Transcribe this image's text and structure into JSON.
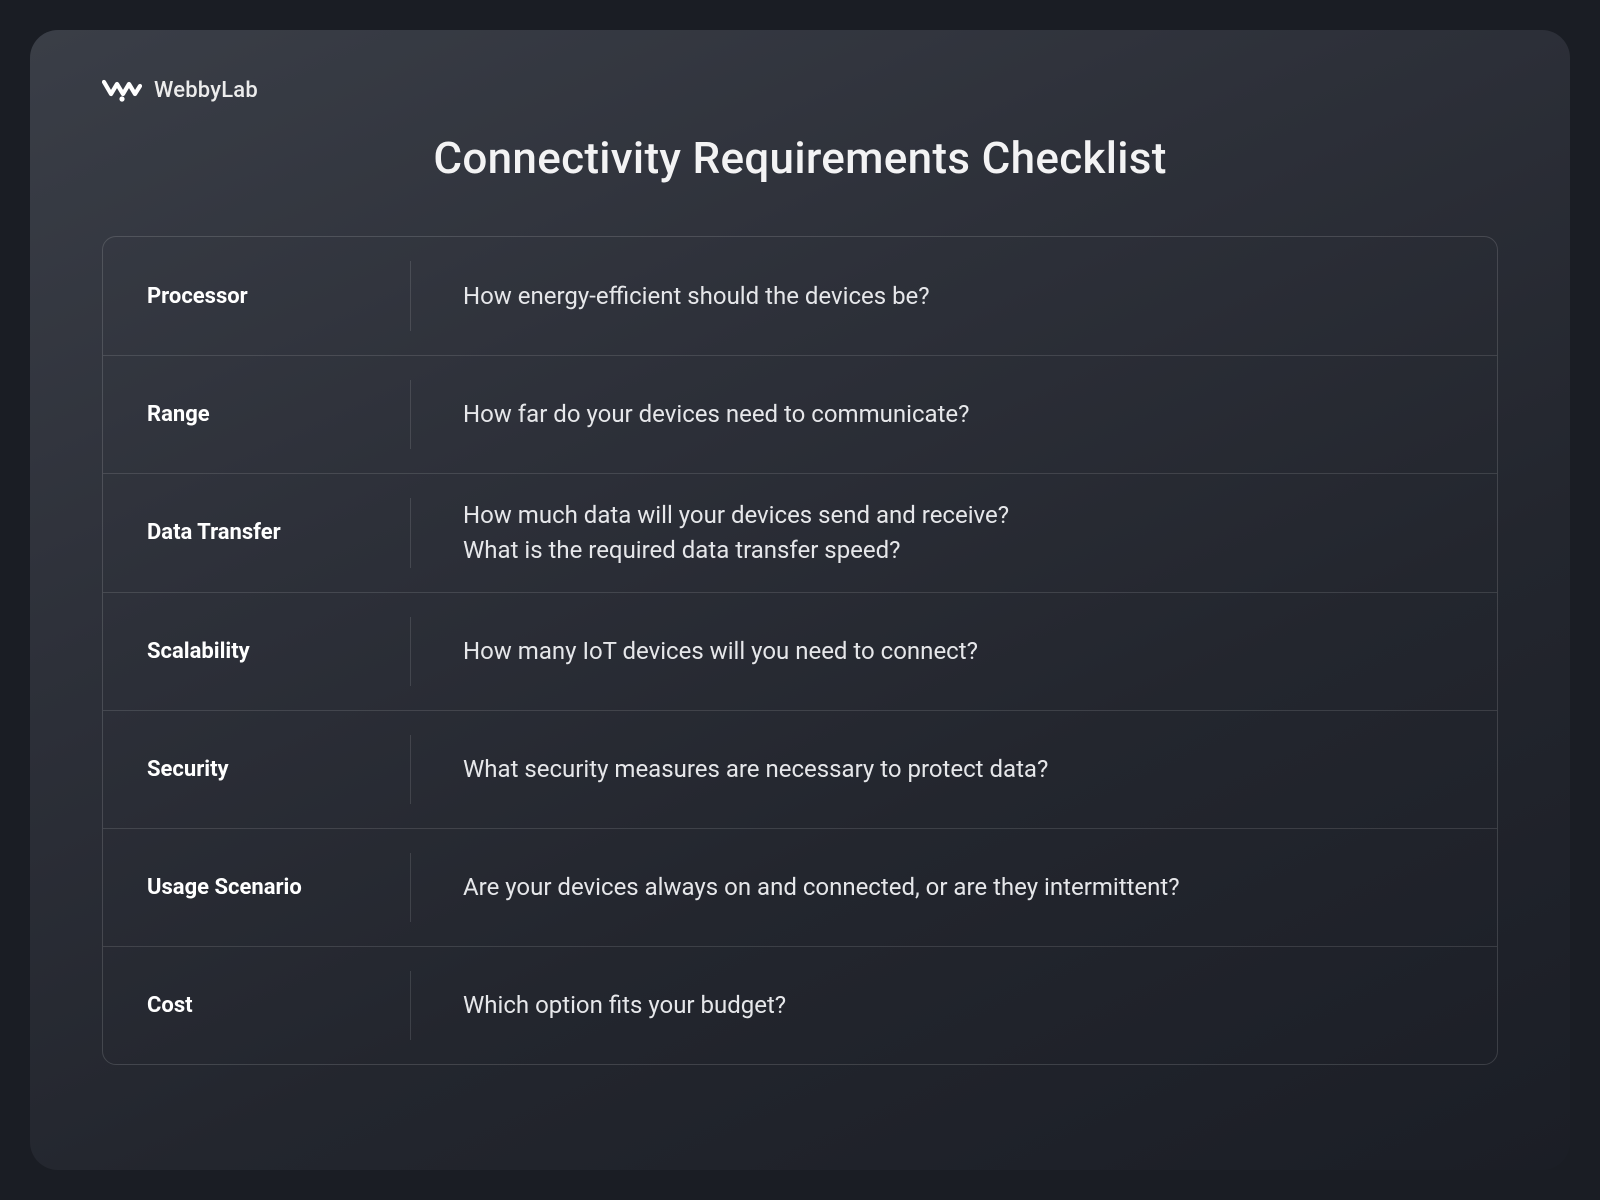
{
  "brand": {
    "name": "WebbyLab"
  },
  "title": "Connectivity Requirements Checklist",
  "rows": [
    {
      "label": "Processor",
      "body": "How energy-efficient should the devices be?"
    },
    {
      "label": "Range",
      "body": "How far do your devices need to communicate?"
    },
    {
      "label": "Data Transfer",
      "body": "How much data will your devices send and receive?\nWhat is the required data transfer speed?"
    },
    {
      "label": "Scalability",
      "body": "How many IoT devices will you need to connect?"
    },
    {
      "label": "Security",
      "body": "What security measures are necessary to protect data?"
    },
    {
      "label": "Usage Scenario",
      "body": "Are your devices always on and connected, or are they intermittent?"
    },
    {
      "label": "Cost",
      "body": "Which option fits your budget?"
    }
  ]
}
